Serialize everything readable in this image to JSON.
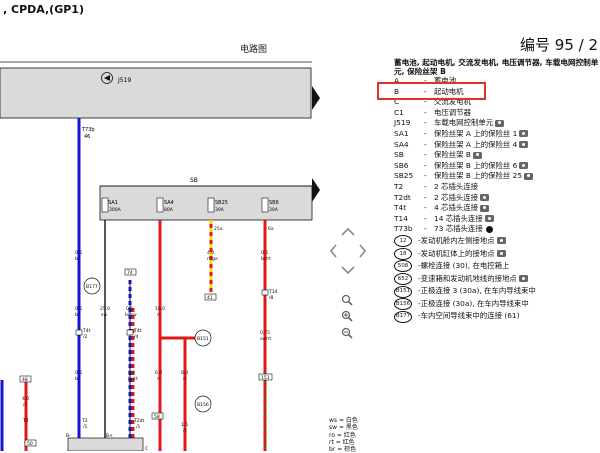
{
  "header": {
    "engine_codes": ", CPDA,(GP1)",
    "doc_type": "电路图",
    "number_label": "编号",
    "page_no": "95 / 2"
  },
  "diagram": {
    "components": {
      "j519": "J519",
      "sb": "SB",
      "t73b": "T73b",
      "t73b_pin": "46"
    },
    "fuses": [
      {
        "id": "SA1",
        "rating": "300A"
      },
      {
        "id": "SA4",
        "rating": "80A"
      },
      {
        "id": "SB25",
        "rating": "30A"
      },
      {
        "id": "SB6",
        "rating": "30A"
      }
    ],
    "wires": [
      {
        "size": "0.5",
        "color": "bl"
      },
      {
        "size": "0.5",
        "color": "bl"
      },
      {
        "size": "25.0",
        "color": "sw"
      },
      {
        "size": "0.5",
        "color": "bl/sw"
      },
      {
        "size": "10.0",
        "color": "rt"
      },
      {
        "size": "4.0",
        "color": "rt/ge"
      },
      {
        "size": "0.5",
        "color": "br/rt"
      },
      {
        "size": "0.75",
        "color": "sw/rt"
      },
      {
        "size": "0.5",
        "color": "br/rt"
      },
      {
        "size": "6.0",
        "color": "rt"
      },
      {
        "size": "6.0",
        "color": "rt"
      },
      {
        "size": "1.5",
        "color": "rt"
      },
      {
        "size": "4.0",
        "color": "rt"
      },
      {
        "size": "0.5",
        "color": "bl"
      }
    ],
    "connection_refs": [
      "B177",
      "B151",
      "B156"
    ],
    "connector_labels": [
      "T4t",
      "T4t",
      "T14",
      "T2",
      "T2dt",
      "T2"
    ],
    "connector_pins": [
      "/2",
      "/4",
      "/8",
      "/1",
      "/1"
    ],
    "fuse_pins": [
      "25a",
      "6a"
    ],
    "ground_labels": [
      "B+",
      "B-",
      "C"
    ],
    "boxes": [
      "74",
      "41",
      "151",
      "58",
      "48",
      "50"
    ]
  },
  "legend": {
    "title": "蓄电池, 起动电机, 交流发电机, 电压调节器, 车载电网控制单元, 保险丝架 B",
    "items": [
      {
        "code": "A",
        "desc": "蓄电池",
        "camera": false,
        "figure": false
      },
      {
        "code": "B",
        "desc": "起动电机",
        "camera": false,
        "figure": false
      },
      {
        "code": "C",
        "desc": "交流发电机",
        "camera": false,
        "figure": false
      },
      {
        "code": "C1",
        "desc": "电压调节器",
        "camera": false,
        "figure": false
      },
      {
        "code": "J519",
        "desc": "车载电网控制单元",
        "camera": true,
        "figure": false
      },
      {
        "code": "SA1",
        "desc": "保险丝架 A 上的保险丝 1",
        "camera": true,
        "figure": false
      },
      {
        "code": "SA4",
        "desc": "保险丝架 A 上的保险丝 4",
        "camera": true,
        "figure": false
      },
      {
        "code": "SB",
        "desc": "保险丝架 B",
        "camera": true,
        "figure": false
      },
      {
        "code": "SB6",
        "desc": "保险丝架 B 上的保险丝 6",
        "camera": true,
        "figure": false
      },
      {
        "code": "SB25",
        "desc": "保险丝架 B 上的保险丝 25",
        "camera": true,
        "figure": false
      },
      {
        "code": "T2",
        "desc": "2 芯插头连接",
        "camera": false,
        "figure": false
      },
      {
        "code": "T2dt",
        "desc": "2 芯插头连接",
        "camera": true,
        "figure": false
      },
      {
        "code": "T4t",
        "desc": "4 芯插头连接",
        "camera": true,
        "figure": false
      },
      {
        "code": "T14",
        "desc": "14 芯插头连接",
        "camera": true,
        "figure": false
      },
      {
        "code": "T73b",
        "desc": "73 芯插头连接",
        "camera": false,
        "figure": true
      }
    ],
    "connections": [
      {
        "code": "12",
        "desc": "发动机舱内左侧接地点",
        "camera": true
      },
      {
        "code": "18",
        "desc": "发动机缸体上的接地点",
        "camera": true
      },
      {
        "code": "508",
        "desc": "螺栓连接 (30), 在电控箱上",
        "camera": false
      },
      {
        "code": "652",
        "desc": "变速箱和发动机地线的接地点",
        "camera": true
      },
      {
        "code": "B151",
        "desc": "正极连接 3 (30a), 在车内导线束中",
        "camera": false
      },
      {
        "code": "B156",
        "desc": "正极连接 (30a), 在车内导线束中",
        "camera": false
      },
      {
        "code": "B177",
        "desc": "车内空间导线束中的连接 (61)",
        "camera": false
      }
    ]
  },
  "wire_colors": [
    {
      "abbr": "ws",
      "name": "白色"
    },
    {
      "abbr": "sw",
      "name": "黑色"
    },
    {
      "abbr": "ro",
      "name": "红色"
    },
    {
      "abbr": "rt",
      "name": "红色"
    },
    {
      "abbr": "br",
      "name": "棕色"
    }
  ],
  "theme": {
    "blue_wire": "#1414d4",
    "red_wire": "#e01818",
    "yellow_wire": "#f0e000",
    "highlight": "#e03030"
  }
}
